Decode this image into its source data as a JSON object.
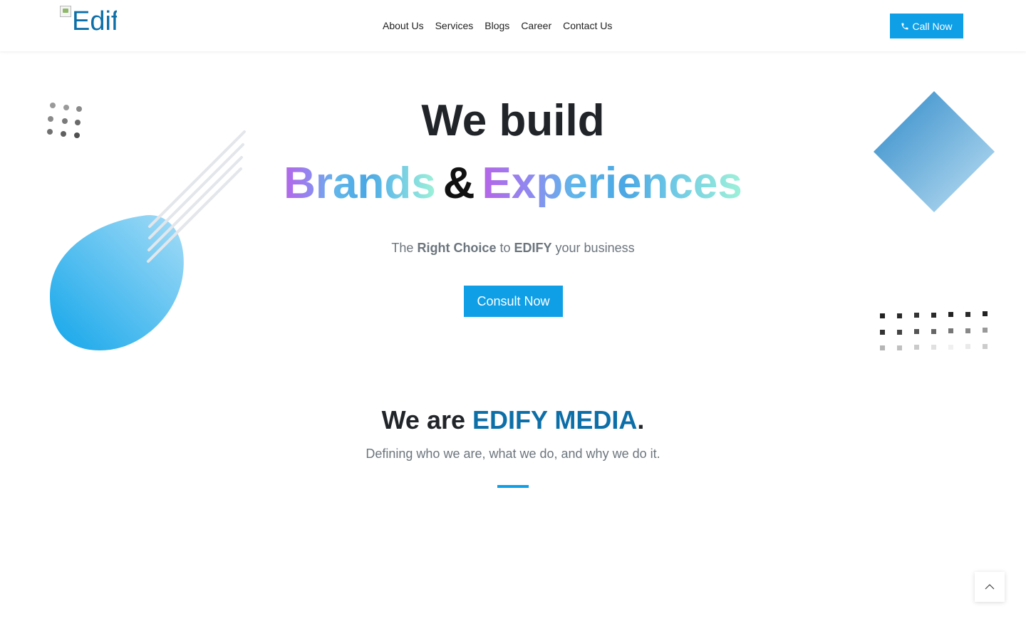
{
  "header": {
    "logo_alt": "Edify",
    "nav": [
      "About Us",
      "Services",
      "Blogs",
      "Career",
      "Contact Us"
    ],
    "call_label": "Call Now",
    "call_icon": "phone-icon"
  },
  "hero": {
    "title": "We build",
    "word1": "Brands",
    "amp": "&",
    "word2": "Experiences",
    "tag_the": "The",
    "tag_right_choice": "Right Choice",
    "tag_to": "to",
    "tag_edify": "EDIFY",
    "tag_rest": "your business",
    "consult_label": "Consult Now"
  },
  "about": {
    "title_prefix": "We are",
    "title_brand": "EDIFY MEDIA",
    "title_suffix": ".",
    "description": "Defining who we are, what we do, and why we do it."
  },
  "colors": {
    "accent": "#0e9fe6",
    "brand": "#0d6fa8",
    "text_dark": "#212529",
    "text_muted": "#6c757d"
  },
  "icons": {
    "back_to_top": "chevron-up-icon"
  }
}
